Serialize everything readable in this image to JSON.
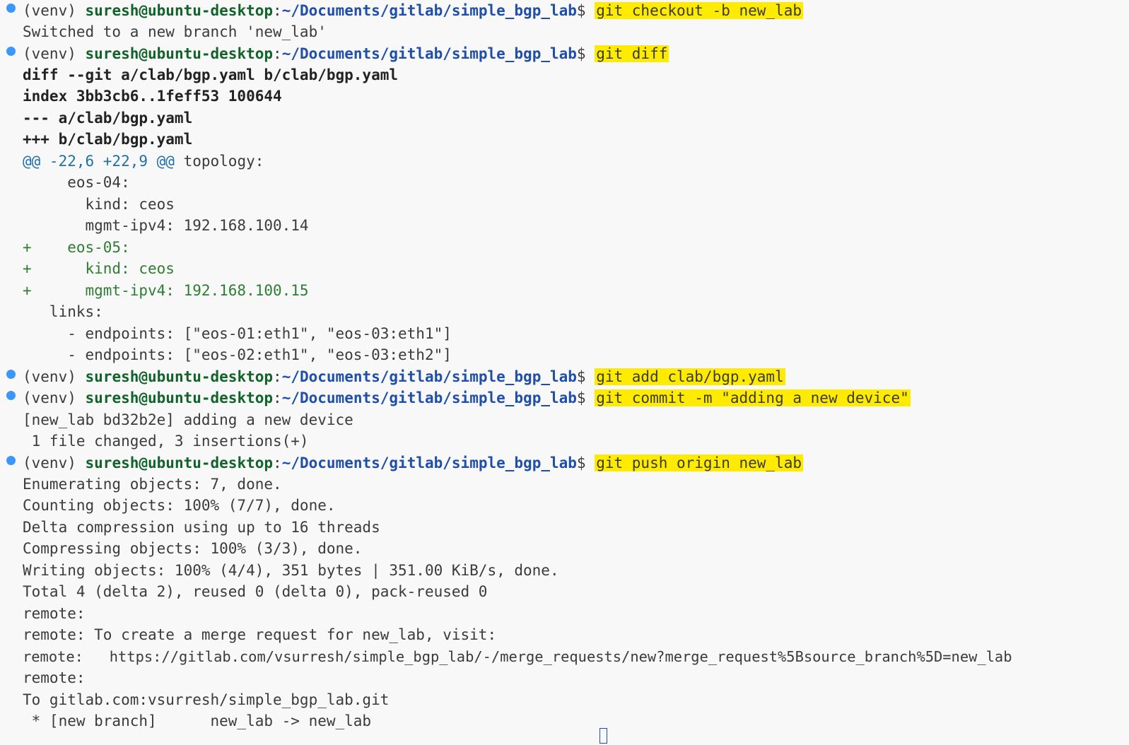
{
  "colors": {
    "background": "#f8f8f8",
    "text": "#3b3b3b",
    "prompt_user": "#116329",
    "prompt_path": "#1f4fa8",
    "highlight": "#ffeb00",
    "diff_added": "#2e7d32",
    "diff_hunk": "#1f6fa8",
    "status_dot": "#1a85ff"
  },
  "prompt": {
    "venv": "(venv) ",
    "user_host": "suresh@ubuntu-desktop",
    "colon": ":",
    "path": "~/Documents/gitlab/simple_bgp_lab",
    "dollar": "$ "
  },
  "commands": {
    "checkout": "git checkout -b new_lab",
    "diff": "git diff",
    "add": "git add clab/bgp.yaml",
    "commit": "git commit -m \"adding a new device\"",
    "push": "git push origin new_lab"
  },
  "output": {
    "checkout": [
      "Switched to a new branch 'new_lab'"
    ],
    "diff_header": [
      "diff --git a/clab/bgp.yaml b/clab/bgp.yaml",
      "index 3bb3cb6..1feff53 100644",
      "--- a/clab/bgp.yaml",
      "+++ b/clab/bgp.yaml"
    ],
    "hunk_marker": "@@ -22,6 +22,9 @@",
    "hunk_context": " topology:",
    "diff_context_top": [
      "     eos-04:",
      "       kind: ceos",
      "       mgmt-ipv4: 192.168.100.14"
    ],
    "diff_added": [
      "+    eos-05:",
      "+      kind: ceos",
      "+      mgmt-ipv4: 192.168.100.15"
    ],
    "diff_context_bottom": [
      "   links:",
      "     - endpoints: [\"eos-01:eth1\", \"eos-03:eth1\"]",
      "     - endpoints: [\"eos-02:eth1\", \"eos-03:eth2\"]"
    ],
    "commit": [
      "[new_lab bd32b2e] adding a new device",
      " 1 file changed, 3 insertions(+)"
    ],
    "push": [
      "Enumerating objects: 7, done.",
      "Counting objects: 100% (7/7), done.",
      "Delta compression using up to 16 threads",
      "Compressing objects: 100% (3/3), done.",
      "Writing objects: 100% (4/4), 351 bytes | 351.00 KiB/s, done.",
      "Total 4 (delta 2), reused 0 (delta 0), pack-reused 0",
      "remote:",
      "remote: To create a merge request for new_lab, visit:",
      "remote:   https://gitlab.com/vsurresh/simple_bgp_lab/-/merge_requests/new?merge_request%5Bsource_branch%5D=new_lab",
      "remote:",
      "To gitlab.com:vsurresh/simple_bgp_lab.git",
      " * [new branch]      new_lab -> new_lab"
    ]
  }
}
